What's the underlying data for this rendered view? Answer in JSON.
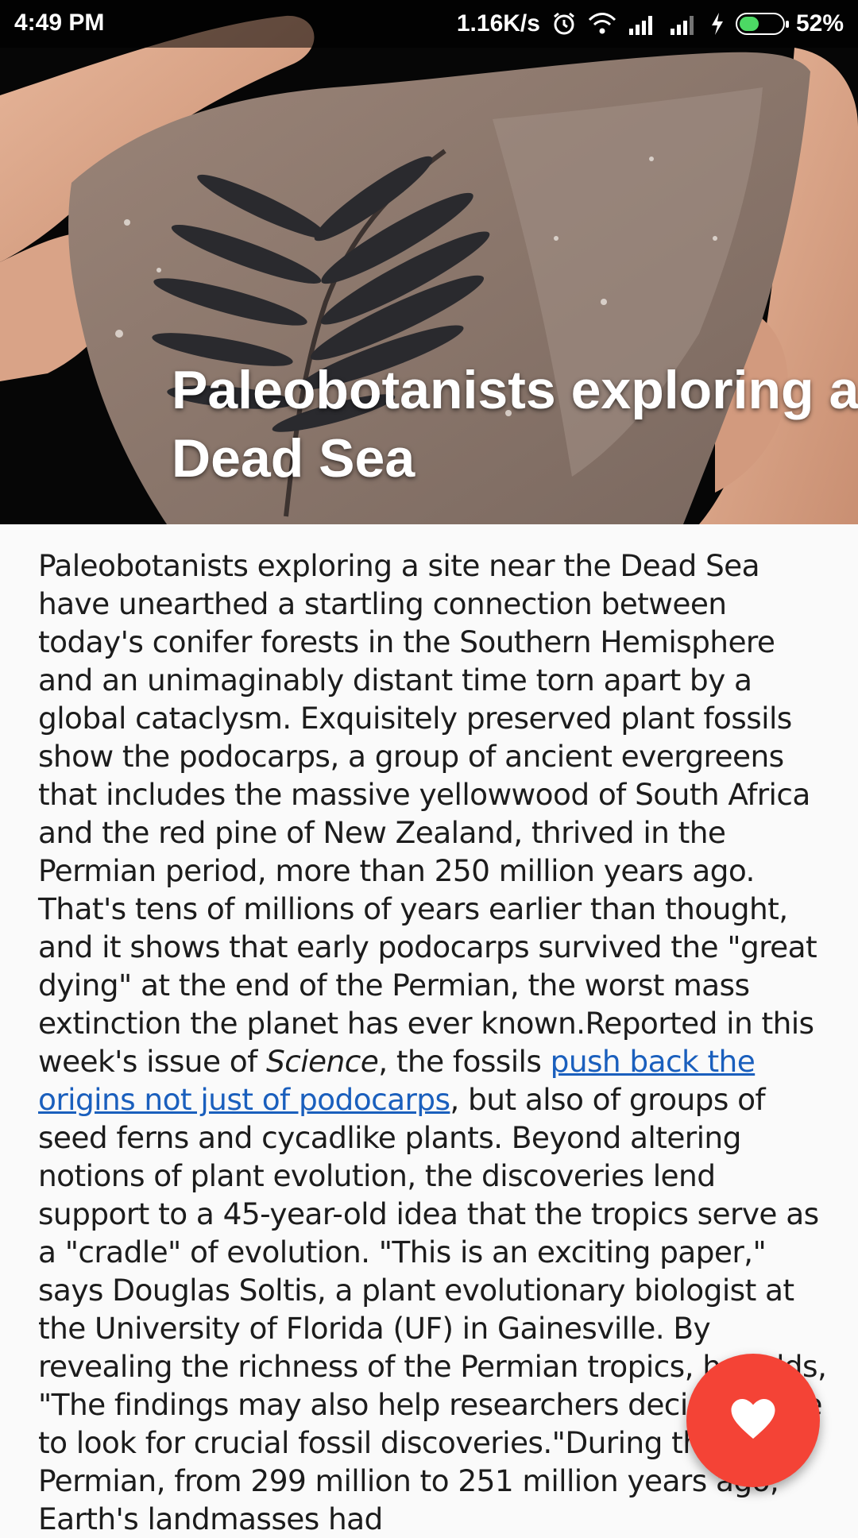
{
  "status_bar": {
    "time": "4:49 PM",
    "network_speed": "1.16K/s",
    "battery_percent": "52%",
    "battery_level": 0.52,
    "icons": [
      "alarm-icon",
      "wifi-icon",
      "signal-icon",
      "signal-icon",
      "charging-icon",
      "battery-icon"
    ]
  },
  "hero": {
    "image": "fern-fossil-in-hand",
    "title_line1": "Paleobotanists exploring a",
    "title_line2": "Dead Sea"
  },
  "article": {
    "part1": "Paleobotanists exploring a site near the Dead Sea have unearthed a startling connection between today's conifer forests in the Southern Hemisphere and an unimaginably distant time torn apart by a global cataclysm. Exquisitely preserved plant fossils show the podocarps, a group of ancient evergreens that includes the massive yellowwood of South Africa and the red pine of New Zealand, thrived in the Permian period, more than 250 million years ago. That's tens of millions of years earlier than thought, and it shows that early podocarps survived the \"great dying\" at the end of the Permian, the worst mass extinction the planet has ever known.Reported in this week's issue of ",
    "italic": "Science",
    "part2": ", the fossils ",
    "link_text": "push back the origins not just of podocarps",
    "part3": ", but also of groups of seed ferns and cycadlike plants. Beyond altering notions of plant evolution, the discoveries lend support to a 45-year-old idea that the tropics serve as a \"cradle\" of evolution. \"This is an exciting paper,\" says Douglas Soltis, a plant evolutionary biologist at the University of Florida (UF) in Gainesville. By revealing the richness of the Permian tropics, he adds, \"The findings may also help researchers decide where to look for crucial fossil discoveries.\"During the Permian, from 299 million to 251 million years ago, Earth's landmasses had"
  },
  "fab": {
    "icon": "heart-icon",
    "color": "#f44336"
  }
}
